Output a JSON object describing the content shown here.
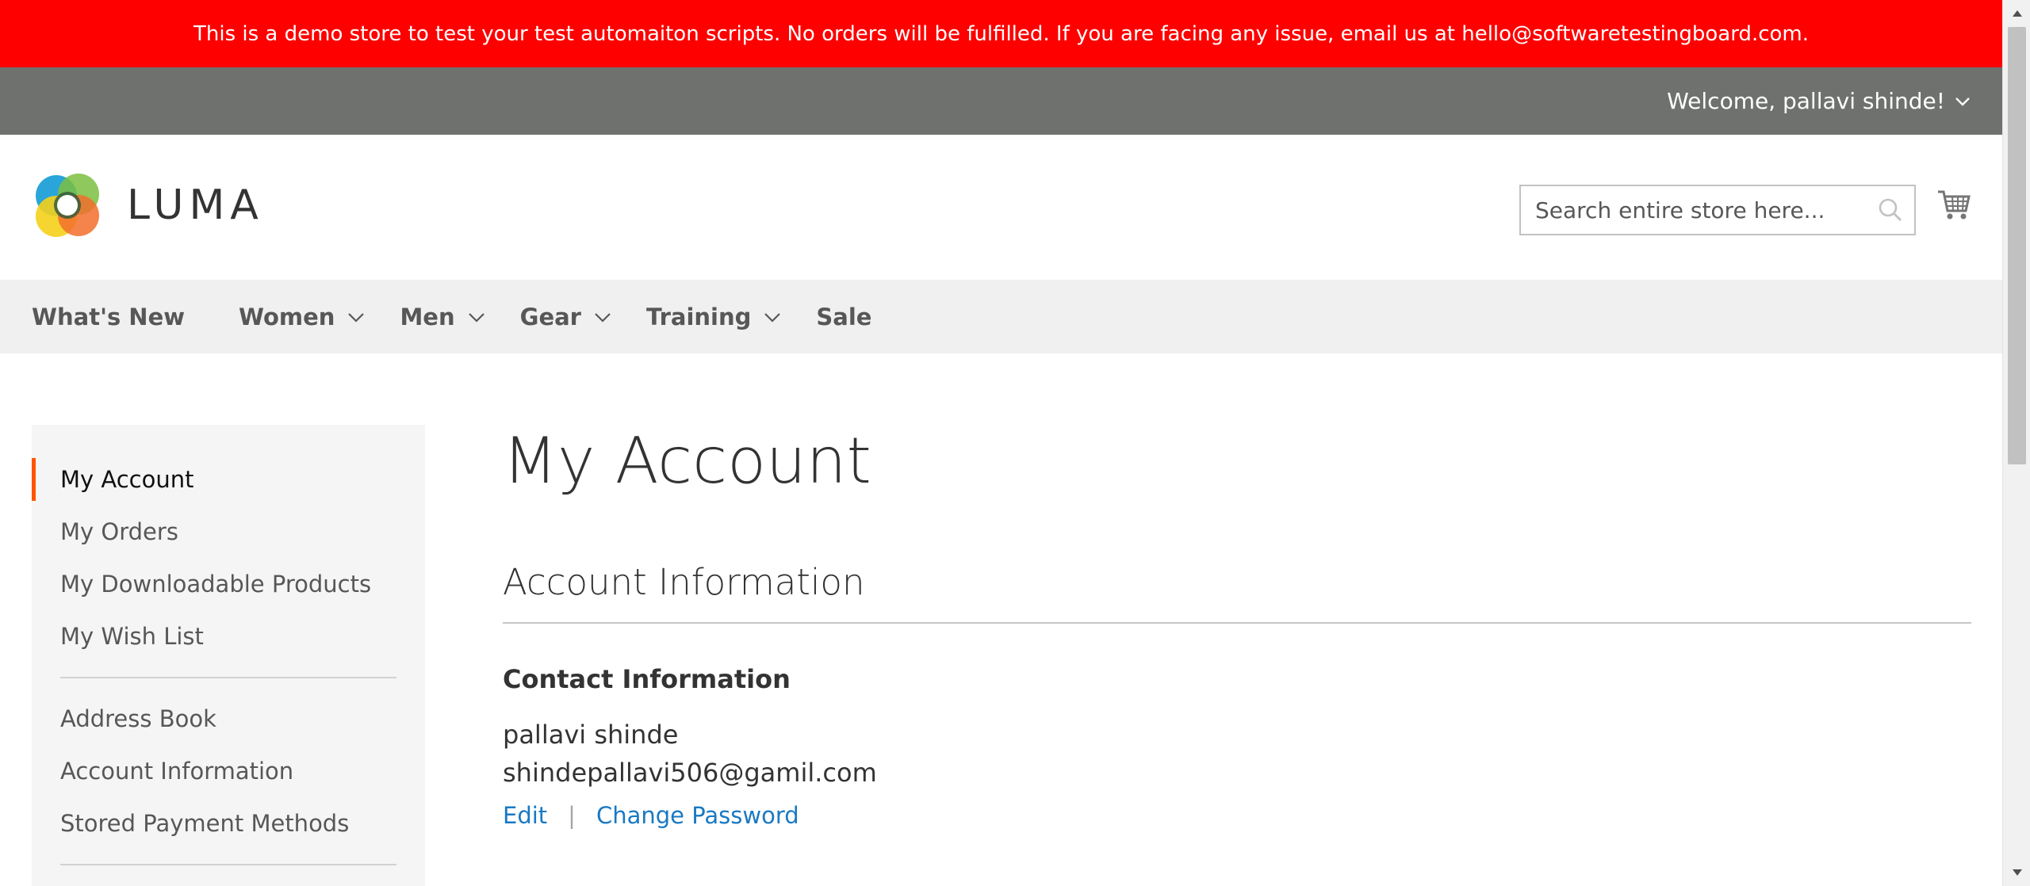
{
  "demo_banner": {
    "text": "This is a demo store to test your test automaiton scripts. No orders will be fulfilled. If you are facing any issue, email us at hello@softwaretestingboard.com.",
    "background": "#ff0000"
  },
  "header": {
    "welcome": "Welcome, pallavi shinde!",
    "logo_text": "LUMA",
    "search_placeholder": "Search entire store here...",
    "cart_icon": "shopping-cart-icon"
  },
  "nav": {
    "items": [
      {
        "label": "What's New",
        "has_dropdown": false
      },
      {
        "label": "Women",
        "has_dropdown": true
      },
      {
        "label": "Men",
        "has_dropdown": true
      },
      {
        "label": "Gear",
        "has_dropdown": true
      },
      {
        "label": "Training",
        "has_dropdown": true
      },
      {
        "label": "Sale",
        "has_dropdown": false
      }
    ]
  },
  "sidebar": {
    "group1": [
      {
        "label": "My Account",
        "active": true
      },
      {
        "label": "My Orders"
      },
      {
        "label": "My Downloadable Products"
      },
      {
        "label": "My Wish List"
      }
    ],
    "group2": [
      {
        "label": "Address Book"
      },
      {
        "label": "Account Information"
      },
      {
        "label": "Stored Payment Methods"
      }
    ],
    "accent_color": "#ff5501"
  },
  "main": {
    "title": "My Account",
    "section_title": "Account Information",
    "contact": {
      "heading": "Contact Information",
      "name": "pallavi shinde",
      "email": "shindepallavi506@gamil.com",
      "edit_label": "Edit",
      "separator": "|",
      "change_password_label": "Change Password"
    },
    "link_color": "#1979c3"
  }
}
